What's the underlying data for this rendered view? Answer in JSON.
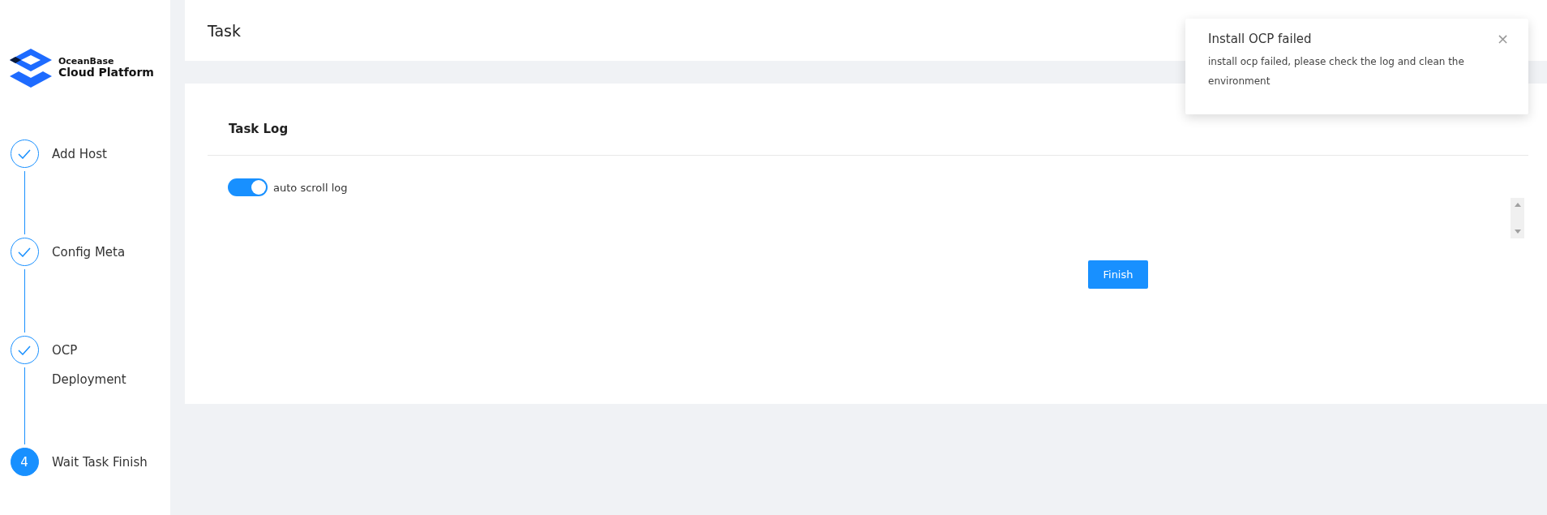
{
  "logo": {
    "line_1": "OceanBase",
    "line_2": "Cloud Platform"
  },
  "steps": [
    {
      "label": "Add Host",
      "done": true
    },
    {
      "label": "Config Meta",
      "done": true
    },
    {
      "label": "OCP Deployment",
      "done": true
    },
    {
      "label": "Wait Task Finish",
      "done": false,
      "number": "4"
    }
  ],
  "header": {
    "title": "Task"
  },
  "task_log": {
    "title": "Task Log",
    "auto_scroll": {
      "label": "auto scroll log",
      "on": true
    },
    "finish_button": "Finish"
  },
  "notification": {
    "title": "Install OCP failed",
    "message": "install ocp failed, please check the log and clean the environment",
    "close": "×"
  }
}
